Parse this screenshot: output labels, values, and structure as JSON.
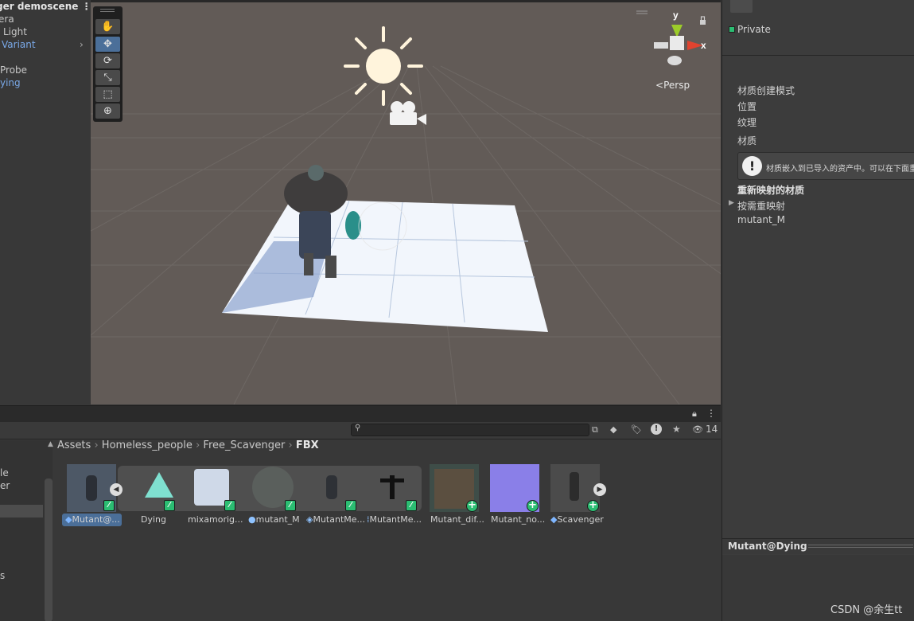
{
  "hierarchy": {
    "title": "ger demoscene",
    "items": [
      {
        "label": "era"
      },
      {
        "label": "Light"
      },
      {
        "label": "Variant"
      },
      {
        "label": "Probe"
      },
      {
        "label": "ying"
      }
    ]
  },
  "scene": {
    "persp_label": "Persp",
    "gizmo_y": "y",
    "gizmo_x": "x"
  },
  "tools": [
    "hand-tool-icon",
    "move-tool-icon",
    "rotate-tool-icon",
    "scale-tool-icon",
    "rect-tool-icon",
    "transform-tool-icon"
  ],
  "inspector": {
    "private_label": "Private",
    "rows": [
      "材质创建模式",
      "位置",
      "纹理",
      "材质"
    ],
    "info_text": "材质嵌入到已导入的资产中。可以在下面重",
    "remapped_header": "重新映射的材质",
    "on_demand_label": "按需重映射",
    "material_name": "mutant_M",
    "preview_title": "Mutant@Dying"
  },
  "project": {
    "left_labels": [
      "le",
      "er",
      "s"
    ],
    "search_placeholder": "",
    "hidden_count": "14",
    "breadcrumb": [
      "Assets",
      "Homeless_people",
      "Free_Scavenger",
      "FBX"
    ],
    "assets": [
      {
        "label": "Mutant@...",
        "selected": true
      },
      {
        "label": "Dying"
      },
      {
        "label": "mixamorig..."
      },
      {
        "label": "mutant_M"
      },
      {
        "label": "MutantMe..."
      },
      {
        "label": "MutantMe..."
      },
      {
        "label": "Mutant_dif..."
      },
      {
        "label": "Mutant_no..."
      },
      {
        "label": "Scavenger"
      }
    ]
  },
  "watermark": "CSDN @余生tt",
  "colors": {
    "scene_bg": "#625b57",
    "panel_bg": "#383838",
    "selection": "#4b6f99",
    "badge_green": "#2bbd72",
    "link_blue": "#7aa9e8"
  }
}
